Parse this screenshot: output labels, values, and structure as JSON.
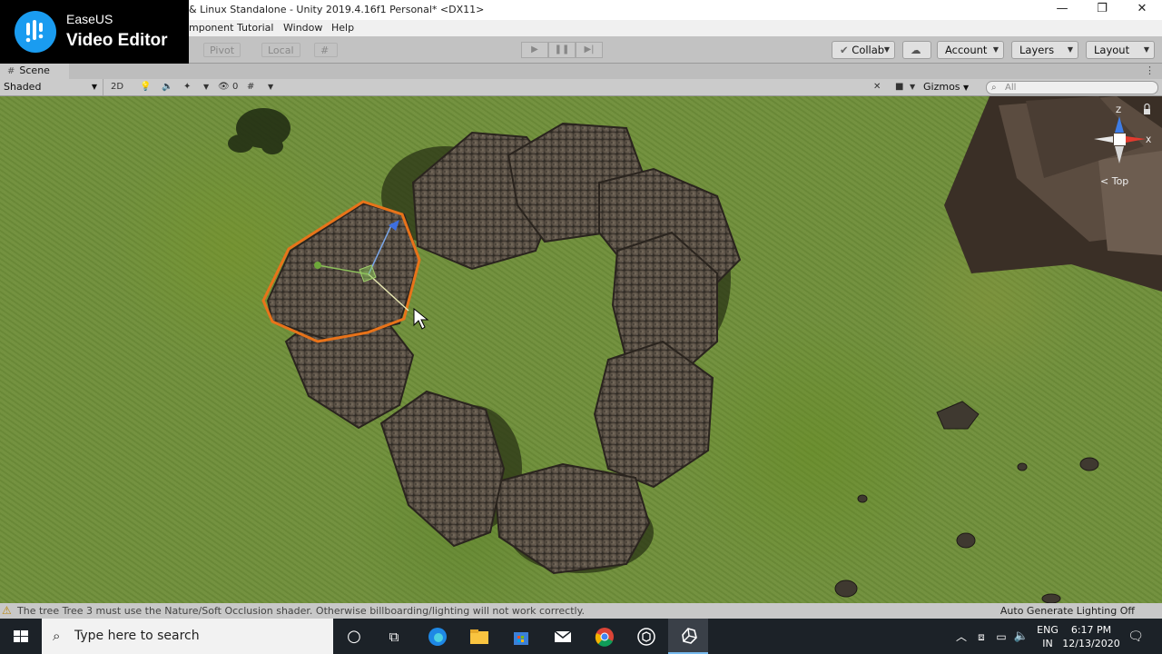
{
  "window": {
    "title": "& Linux Standalone - Unity 2019.4.16f1 Personal* <DX11>",
    "controls": {
      "minimize": "—",
      "restore": "❐",
      "close": "✕"
    }
  },
  "watermark": {
    "line1": "EaseUS",
    "line2": "Video Editor"
  },
  "menu": {
    "component": "mponent",
    "tutorial": "Tutorial",
    "window": "Window",
    "help": "Help"
  },
  "toolbar": {
    "pivot": "Pivot",
    "local": "Local",
    "collab": "Collab",
    "account": "Account",
    "layers": "Layers",
    "layout": "Layout"
  },
  "scene_tab": {
    "label": "Scene"
  },
  "scene_bar": {
    "draw_mode": "Shaded",
    "toggle_2d": "2D",
    "hidden_count": "0",
    "gizmos": "Gizmos",
    "search_placeholder": "All"
  },
  "gizmo": {
    "axis_z": "Z",
    "axis_x": "X",
    "view_label": "Top"
  },
  "status": {
    "warning": "The tree Tree 3 must use the Nature/Soft Occlusion shader. Otherwise billboarding/lighting will not work correctly.",
    "lighting": "Auto Generate Lighting Off"
  },
  "taskbar": {
    "search_placeholder": "Type here to search",
    "language": "ENG",
    "region": "IN",
    "time": "6:17 PM",
    "date": "12/13/2020"
  },
  "colors": {
    "selection_outline": "#e8731a",
    "taskbar": "#1c2228",
    "accent": "#76b9ed"
  }
}
